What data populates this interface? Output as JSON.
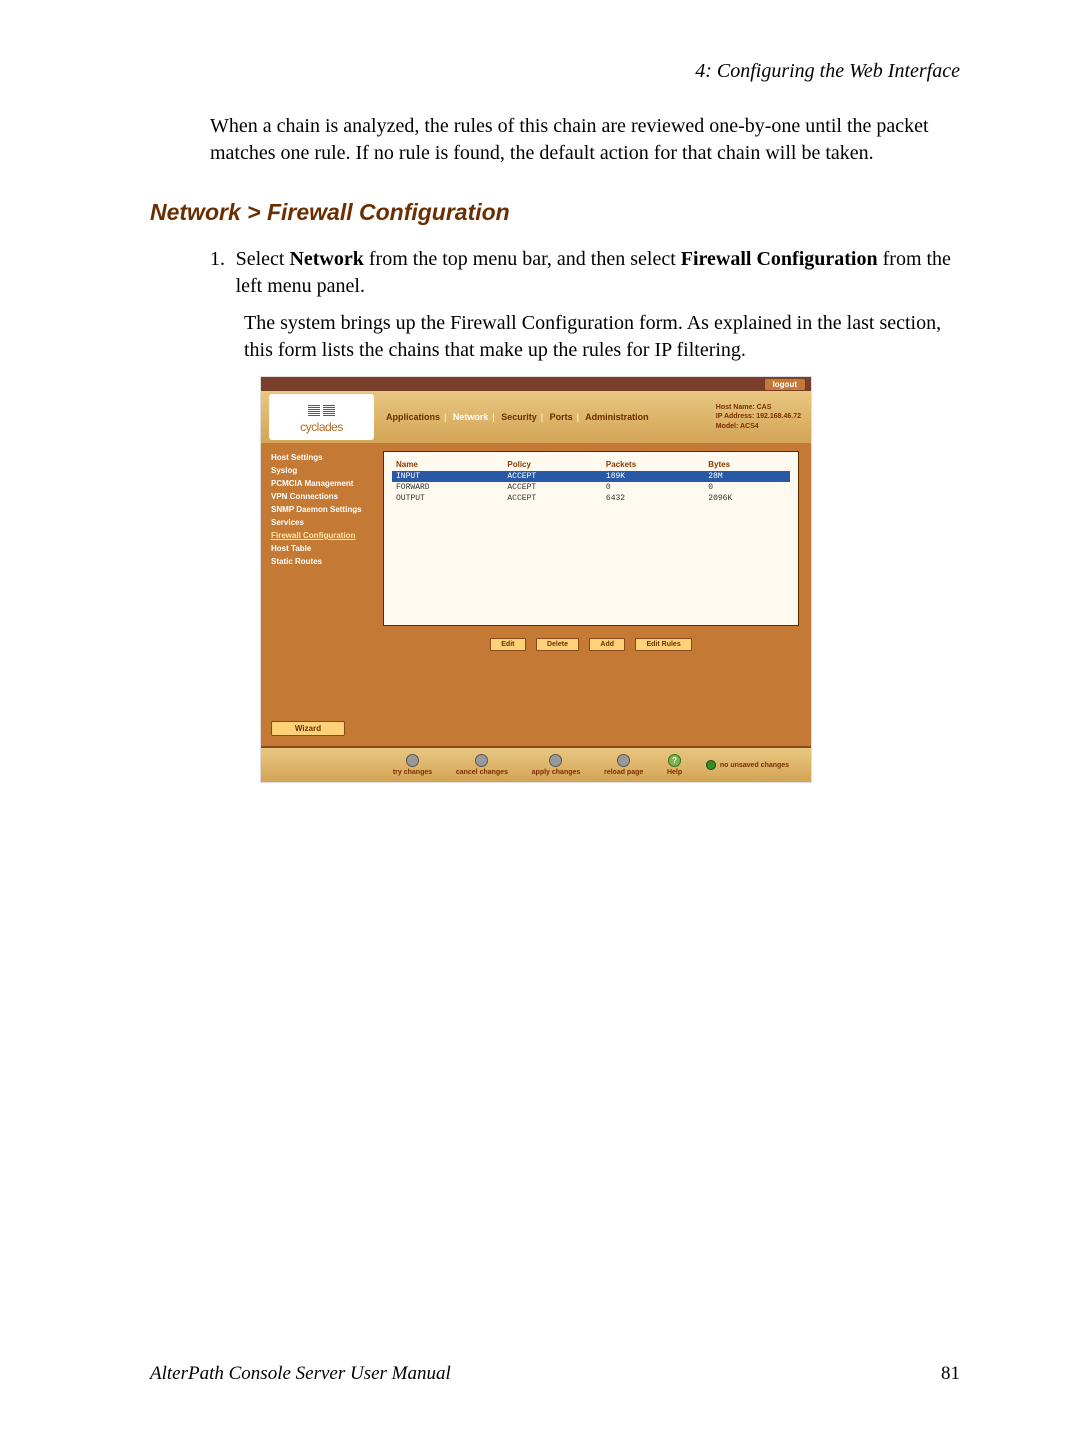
{
  "chapter_header": "4: Configuring the Web Interface",
  "intro_paragraph": "When a chain is analyzed, the rules of this chain are reviewed one-by-one until the packet matches one rule. If no rule is found, the default action for that chain will be taken.",
  "section_heading": "Network > Firewall Configuration",
  "step": {
    "number": "1.",
    "line1_pre": "Select ",
    "line1_b1": "Network",
    "line1_mid": " from the top menu bar, and then select ",
    "line1_b2": "Firewall Configuration",
    "line1_post": " from the left menu panel.",
    "para2": "The system brings up the Firewall Configuration form. As explained in the last section, this form lists the chains that make up the rules for IP filtering."
  },
  "screenshot": {
    "logout": "logout",
    "logo_text": "cyclades",
    "tabs": [
      "Applications",
      "Network",
      "Security",
      "Ports",
      "Administration"
    ],
    "tabs_active_index": 1,
    "hostinfo": {
      "l1": "Host Name: CAS",
      "l2": "IP Address: 192.168.46.72",
      "l3": "Model: ACS4"
    },
    "side_menu": [
      "Host Settings",
      "Syslog",
      "PCMCIA Management",
      "VPN Connections",
      "SNMP Daemon Settings",
      "Services",
      "Firewall Configuration",
      "Host Table",
      "Static Routes"
    ],
    "side_menu_active_index": 6,
    "wizard": "Wizard",
    "table": {
      "headers": [
        "Name",
        "Policy",
        "Packets",
        "Bytes"
      ],
      "rows": [
        {
          "name": "INPUT",
          "policy": "ACCEPT",
          "packets": "189K",
          "bytes": "28M",
          "selected": true
        },
        {
          "name": "FORWARD",
          "policy": "ACCEPT",
          "packets": "0",
          "bytes": "0"
        },
        {
          "name": "OUTPUT",
          "policy": "ACCEPT",
          "packets": "6432",
          "bytes": "2096K"
        }
      ]
    },
    "buttons": [
      "Edit",
      "Delete",
      "Add",
      "Edit Rules"
    ],
    "footer": {
      "try": "try changes",
      "cancel": "cancel changes",
      "apply": "apply changes",
      "reload": "reload page",
      "help": "Help",
      "unsaved": "no unsaved changes"
    }
  },
  "page_footer": {
    "title": "AlterPath Console Server User Manual",
    "page": "81"
  }
}
